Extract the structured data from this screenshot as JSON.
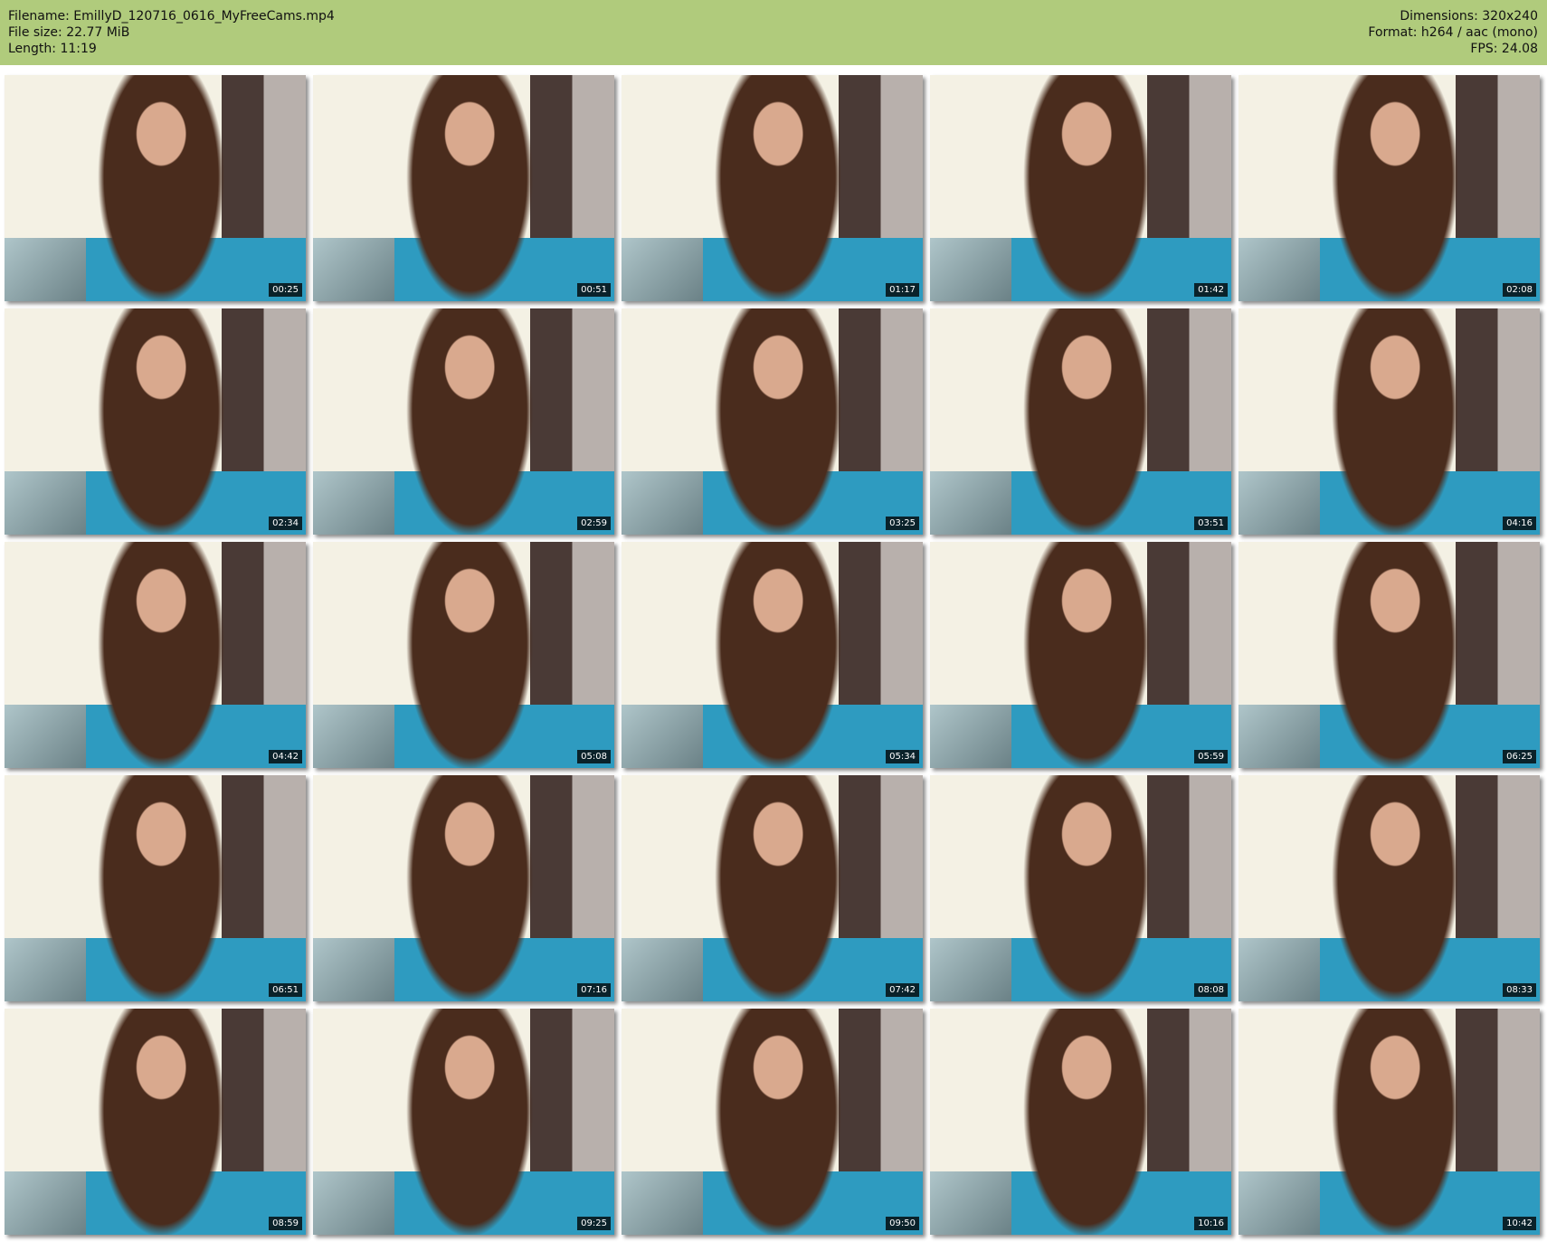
{
  "header": {
    "filename": "Filename: EmillyD_120716_0616_MyFreeCams.mp4",
    "filesize": "File size: 22.77 MiB",
    "length": "Length: 11:19",
    "dimensions": "Dimensions: 320x240",
    "format": "Format: h264 / aac (mono)",
    "fps": "FPS: 24.08"
  },
  "colors": {
    "header_bg": "#b0cb7c"
  },
  "thumbnails": [
    {
      "time": "00:25"
    },
    {
      "time": "00:51"
    },
    {
      "time": "01:17"
    },
    {
      "time": "01:42"
    },
    {
      "time": "02:08"
    },
    {
      "time": "02:34"
    },
    {
      "time": "02:59"
    },
    {
      "time": "03:25"
    },
    {
      "time": "03:51"
    },
    {
      "time": "04:16"
    },
    {
      "time": "04:42"
    },
    {
      "time": "05:08"
    },
    {
      "time": "05:34"
    },
    {
      "time": "05:59"
    },
    {
      "time": "06:25"
    },
    {
      "time": "06:51"
    },
    {
      "time": "07:16"
    },
    {
      "time": "07:42"
    },
    {
      "time": "08:08"
    },
    {
      "time": "08:33"
    },
    {
      "time": "08:59"
    },
    {
      "time": "09:25"
    },
    {
      "time": "09:50"
    },
    {
      "time": "10:16"
    },
    {
      "time": "10:42"
    }
  ]
}
